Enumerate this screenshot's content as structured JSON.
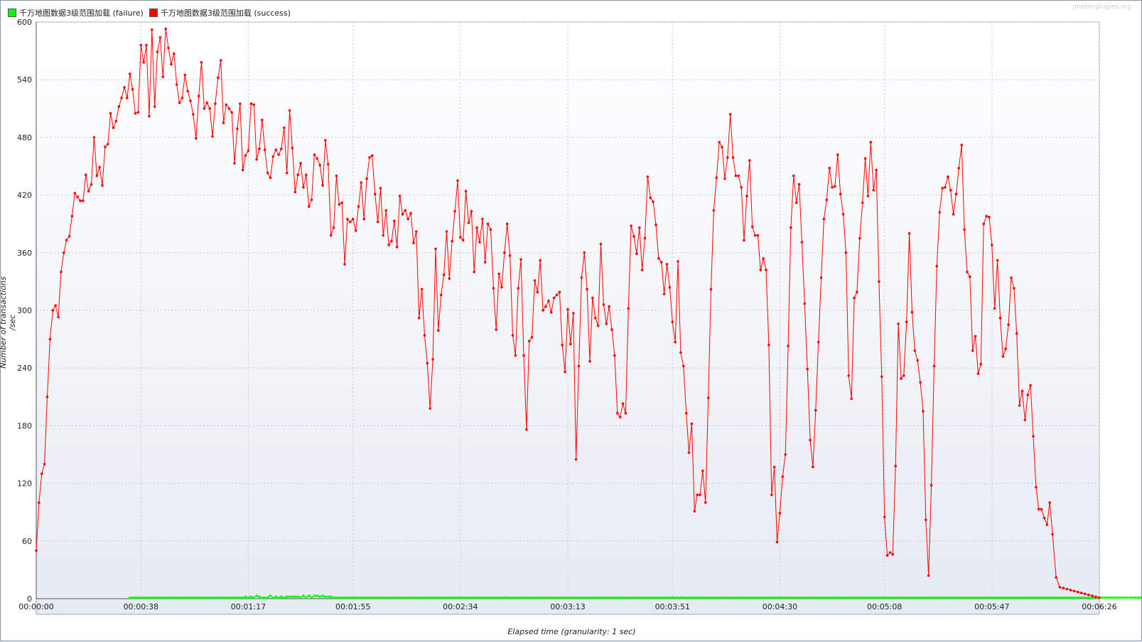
{
  "legend": {
    "failure_label": "千万地图数据3级范围加载 (failure)",
    "success_label": "千万地图数据3级范围加载 (success)"
  },
  "watermark": "jmeter-plugins.org",
  "colors": {
    "failure": "#00ff00",
    "success": "#ff0000",
    "failure_line": "#00c000",
    "success_line": "#ff0000"
  },
  "chart_data": {
    "type": "line",
    "xlabel": "Elapsed time (granularity: 1 sec)",
    "ylabel": "Number of transactions /sec",
    "ylim": [
      0,
      600
    ],
    "xlim": [
      0,
      386
    ],
    "x_ticks": [
      {
        "v": 0,
        "label": "00:00:00"
      },
      {
        "v": 38,
        "label": "00:00:38"
      },
      {
        "v": 77,
        "label": "00:01:17"
      },
      {
        "v": 115,
        "label": "00:01:55"
      },
      {
        "v": 154,
        "label": "00:02:34"
      },
      {
        "v": 193,
        "label": "00:03:13"
      },
      {
        "v": 231,
        "label": "00:03:51"
      },
      {
        "v": 270,
        "label": "00:04:30"
      },
      {
        "v": 308,
        "label": "00:05:08"
      },
      {
        "v": 347,
        "label": "00:05:47"
      },
      {
        "v": 386,
        "label": "00:06:26"
      }
    ],
    "y_ticks": [
      0,
      60,
      120,
      180,
      240,
      300,
      360,
      420,
      480,
      540,
      600
    ],
    "grid": true,
    "legend_position": "top-left",
    "series": [
      {
        "name": "千万地图数据3级范围加载 (success)",
        "values": [
          50,
          100,
          130,
          140,
          210,
          270,
          300,
          305,
          293,
          340,
          360,
          373,
          377,
          398,
          422,
          418,
          414,
          414,
          441,
          424,
          431,
          480,
          440,
          449,
          430,
          470,
          473,
          505,
          490,
          497,
          512,
          521,
          532,
          521,
          546,
          530,
          505,
          506,
          576,
          558,
          576,
          502,
          592,
          512,
          569,
          584,
          543,
          593,
          573,
          556,
          567,
          535,
          516,
          521,
          545,
          528,
          518,
          504,
          479,
          523,
          558,
          510,
          516,
          510,
          481,
          515,
          542,
          560,
          495,
          514,
          510,
          506,
          453,
          489,
          515,
          446,
          461,
          466,
          515,
          514,
          457,
          468,
          498,
          467,
          443,
          438,
          460,
          467,
          462,
          468,
          490,
          443,
          508,
          469,
          423,
          441,
          453,
          428,
          441,
          408,
          415,
          462,
          458,
          451,
          430,
          477,
          452,
          378,
          386,
          440,
          410,
          412,
          348,
          395,
          392,
          395,
          383,
          408,
          433,
          395,
          437,
          459,
          461,
          421,
          392,
          427,
          378,
          404,
          368,
          372,
          393,
          366,
          419,
          400,
          404,
          395,
          401,
          370,
          382,
          292,
          322,
          274,
          245,
          198,
          249,
          364,
          279,
          316,
          337,
          382,
          333,
          372,
          403,
          435,
          376,
          373,
          424,
          391,
          403,
          340,
          386,
          371,
          395,
          350,
          390,
          384,
          323,
          280,
          338,
          324,
          360,
          390,
          357,
          274,
          253,
          323,
          353,
          253,
          176,
          268,
          272,
          331,
          319,
          352,
          300,
          304,
          310,
          298,
          313,
          316,
          319,
          264,
          236,
          301,
          265,
          297,
          145,
          242,
          334,
          360,
          322,
          247,
          313,
          292,
          284,
          369,
          306,
          286,
          304,
          280,
          253,
          193,
          189,
          203,
          193,
          302,
          388,
          377,
          359,
          386,
          342,
          375,
          439,
          417,
          413,
          389,
          354,
          350,
          317,
          348,
          324,
          288,
          267,
          351,
          256,
          242,
          193,
          152,
          182,
          91,
          108,
          108,
          133,
          100,
          209,
          322,
          404,
          438,
          475,
          470,
          437,
          459,
          504,
          459,
          440,
          440,
          428,
          373,
          419,
          456,
          387,
          378,
          378,
          342,
          354,
          342,
          264,
          108,
          137,
          59,
          89,
          127,
          150,
          263,
          386,
          440,
          412,
          431,
          371,
          307,
          239,
          165,
          137,
          196,
          267,
          334,
          395,
          415,
          448,
          428,
          429,
          462,
          421,
          400,
          360,
          232,
          208,
          313,
          319,
          375,
          412,
          458,
          419,
          475,
          425,
          446,
          330,
          231,
          85,
          45,
          48,
          46,
          138,
          286,
          229,
          232,
          288,
          380,
          298,
          258,
          248,
          225,
          195,
          82,
          24,
          118,
          242,
          346,
          402,
          427,
          428,
          439,
          425,
          400,
          421,
          448,
          472,
          384,
          340,
          335,
          258,
          273,
          234,
          244,
          390,
          398,
          397,
          368,
          302,
          352,
          292,
          252,
          260,
          285,
          334,
          323,
          276,
          201,
          216,
          186,
          212,
          222,
          169,
          116,
          93,
          93,
          84,
          77,
          100,
          67,
          22,
          12,
          11,
          10,
          9,
          8,
          7,
          6,
          5,
          4,
          3,
          2,
          1
        ],
        "last_x": 386
      },
      {
        "name": "千万地图数据3级范围加载 (failure)",
        "values": [
          1,
          1,
          1,
          1,
          1,
          1,
          1,
          1,
          1,
          1,
          1,
          1,
          1,
          1,
          1,
          1,
          1,
          1,
          1,
          1,
          1,
          1,
          1,
          1,
          1,
          1,
          1,
          1,
          1,
          1,
          1,
          1,
          1,
          1,
          1,
          1,
          1,
          1,
          1,
          1,
          1,
          1,
          2,
          1,
          2,
          1,
          3,
          2,
          1,
          1,
          1,
          3,
          1,
          2,
          1,
          2,
          1,
          2,
          2,
          2,
          2,
          2,
          1,
          3,
          1,
          3,
          1,
          3,
          3,
          2,
          3,
          2,
          2,
          2,
          1,
          1,
          1,
          1,
          1,
          1,
          1,
          1,
          1,
          1,
          1,
          1,
          1,
          1,
          1,
          1,
          1,
          1,
          1,
          1,
          1,
          1,
          1,
          1,
          1,
          1,
          1,
          1,
          1,
          1,
          1,
          1,
          1,
          1,
          1,
          1,
          1,
          1,
          1,
          1,
          1,
          1,
          1,
          1,
          1,
          1,
          1,
          1,
          1,
          1,
          1,
          1,
          1,
          1,
          1,
          1,
          1,
          1,
          1,
          1,
          1,
          1,
          1,
          1,
          1,
          1,
          1,
          1,
          1,
          1,
          1,
          1,
          1,
          1,
          1,
          1,
          1,
          1,
          1,
          1,
          1,
          1,
          1,
          1,
          1,
          1,
          1,
          1,
          1,
          1,
          1,
          1,
          1,
          1,
          1,
          1,
          1,
          1,
          1,
          1,
          1,
          1,
          1,
          1,
          1,
          1,
          1,
          1,
          1,
          1,
          1,
          1,
          1,
          1,
          1,
          1,
          1,
          1,
          1,
          1,
          1,
          1,
          1,
          1,
          1,
          1,
          1,
          1,
          1,
          1,
          1,
          1,
          1,
          1,
          1,
          1,
          1,
          1,
          1,
          1,
          1,
          1,
          1,
          1,
          1,
          1,
          1,
          1,
          1,
          1,
          1,
          1,
          1,
          1,
          1,
          1,
          1,
          1,
          1,
          1,
          1,
          1,
          1,
          1,
          1,
          1,
          1,
          1,
          1,
          1,
          1,
          1,
          1,
          1,
          1,
          1,
          1,
          1,
          1,
          1,
          1,
          1,
          1,
          1,
          1,
          1,
          1,
          1,
          1,
          1,
          1,
          1,
          1,
          1,
          1,
          1,
          1,
          1,
          1,
          1,
          1,
          1,
          1,
          1,
          1,
          1,
          1,
          1,
          1,
          1,
          1,
          1,
          1,
          1,
          1,
          1,
          1,
          1,
          1,
          1,
          1,
          1,
          1,
          1,
          1,
          1,
          1,
          1,
          1,
          1,
          1,
          1,
          1,
          1,
          1,
          1,
          1,
          1,
          1,
          1,
          1,
          1,
          1,
          1,
          1,
          1,
          1,
          1,
          1,
          1,
          1,
          1,
          1,
          1,
          1,
          1,
          1,
          1,
          1,
          1,
          1,
          1,
          1,
          1,
          1,
          1,
          1,
          1,
          1,
          1,
          1,
          1,
          1,
          1,
          1,
          1,
          1,
          1,
          1,
          1,
          1,
          1,
          1,
          1,
          1,
          1,
          1,
          1,
          1,
          1,
          1,
          1,
          1,
          1,
          1,
          1,
          1,
          1,
          1,
          1,
          1,
          1
        ],
        "start_x": 34
      }
    ]
  }
}
